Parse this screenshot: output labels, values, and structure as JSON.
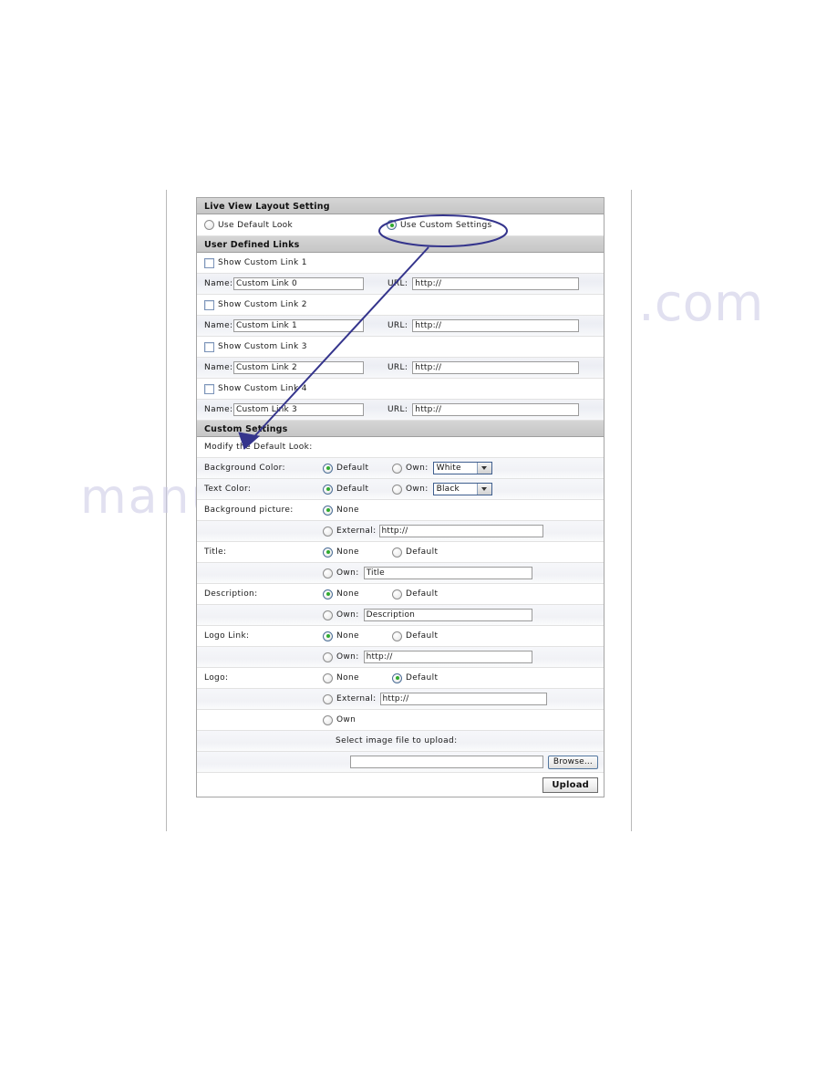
{
  "panel": {
    "sections": {
      "live_view": "Live View Layout Setting",
      "user_links": "User Defined Links",
      "custom_settings": "Custom Settings"
    },
    "layout_choice": {
      "default_look": "Use Default Look",
      "custom_settings": "Use Custom Settings",
      "selected": "custom_settings"
    },
    "links": [
      {
        "checkbox_label": "Show Custom Link  1",
        "checked": false,
        "name_label": "Name:",
        "name_value": "Custom Link 0",
        "url_label": "URL:",
        "url_value": "http://"
      },
      {
        "checkbox_label": "Show Custom Link  2",
        "checked": false,
        "name_label": "Name:",
        "name_value": "Custom Link 1",
        "url_label": "URL:",
        "url_value": "http://"
      },
      {
        "checkbox_label": "Show Custom Link  3",
        "checked": false,
        "name_label": "Name:",
        "name_value": "Custom Link 2",
        "url_label": "URL:",
        "url_value": "http://"
      },
      {
        "checkbox_label": "Show Custom Link  4",
        "checked": false,
        "name_label": "Name:",
        "name_value": "Custom Link 3",
        "url_label": "URL:",
        "url_value": "http://"
      }
    ],
    "custom": {
      "modify_note": "Modify the Default Look:",
      "background_color": {
        "label": "Background Color:",
        "default_label": "Default",
        "own_label": "Own:",
        "own_value": "White",
        "selected": "default"
      },
      "text_color": {
        "label": "Text Color:",
        "default_label": "Default",
        "own_label": "Own:",
        "own_value": "Black",
        "selected": "default"
      },
      "background_picture": {
        "label": "Background picture:",
        "none_label": "None",
        "external_label": "External:",
        "external_value": "http://",
        "selected": "none"
      },
      "title": {
        "label": "Title:",
        "none_label": "None",
        "default_label": "Default",
        "own_label": "Own:",
        "own_value": "Title",
        "selected": "none"
      },
      "description": {
        "label": "Description:",
        "none_label": "None",
        "default_label": "Default",
        "own_label": "Own:",
        "own_value": "Description",
        "selected": "none"
      },
      "logo_link": {
        "label": "Logo Link:",
        "none_label": "None",
        "default_label": "Default",
        "own_label": "Own:",
        "own_value": "http://",
        "selected": "none"
      },
      "logo": {
        "label": "Logo:",
        "none_label": "None",
        "default_label": "Default",
        "external_label": "External:",
        "external_value": "http://",
        "own_label": "Own",
        "selected": "default"
      },
      "upload": {
        "note": "Select image file to upload:",
        "file_value": "",
        "browse_label": "Browse...",
        "upload_label": "Upload"
      }
    }
  },
  "annotation": {
    "highlight_target": "Use Custom Settings",
    "color": "#34348c"
  }
}
